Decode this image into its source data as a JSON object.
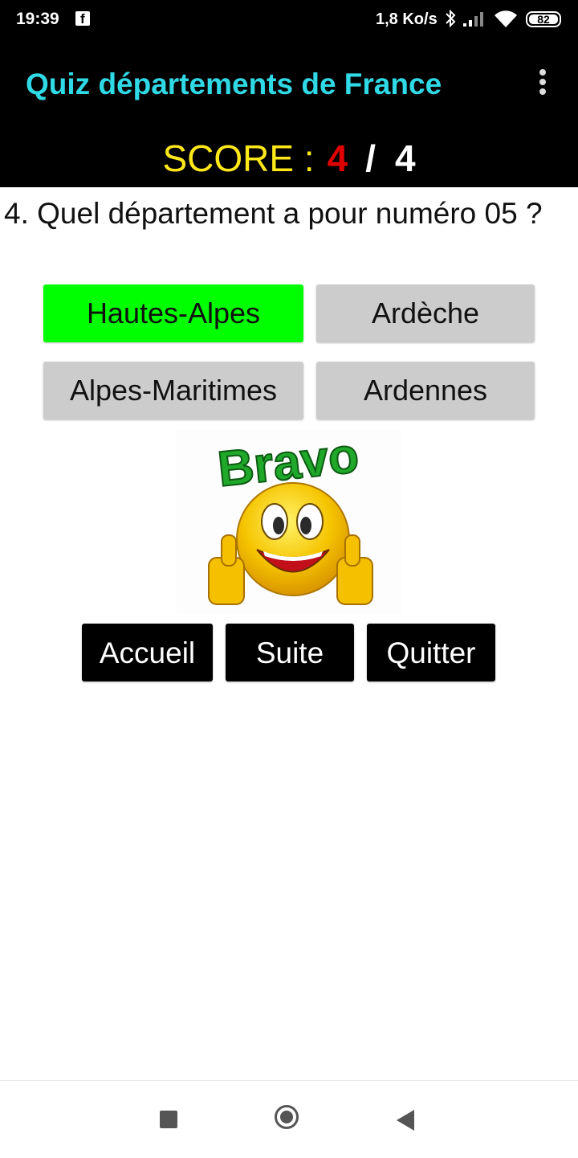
{
  "status_bar": {
    "time": "19:39",
    "network_speed": "1,8 Ko/s",
    "battery": "82",
    "icons": [
      "facebook-icon",
      "bluetooth-icon",
      "signal-icon",
      "wifi-icon",
      "battery-icon"
    ]
  },
  "app_bar": {
    "title": "Quiz départements de France",
    "menu_icon": "more-vert-icon",
    "title_color": "#2fd9e6"
  },
  "score": {
    "label": "SCORE :",
    "value": "4",
    "separator": "/",
    "total": "4",
    "colors": {
      "label": "#ffe81a",
      "value": "#e00000",
      "total": "#ffffff"
    }
  },
  "question": {
    "text": "4. Quel département a pour numéro 05 ?"
  },
  "answers": [
    {
      "label": "Hautes-Alpes",
      "state": "correct",
      "color": "#00ff00"
    },
    {
      "label": "Ardèche",
      "state": "neutral",
      "color": "#cccccc"
    },
    {
      "label": "Alpes-Maritimes",
      "state": "neutral",
      "color": "#cccccc"
    },
    {
      "label": "Ardennes",
      "state": "neutral",
      "color": "#cccccc"
    }
  ],
  "feedback": {
    "image_text": "Bravo",
    "image_icon": "thumbs-up-smiley-icon"
  },
  "actions": {
    "home": "Accueil",
    "next": "Suite",
    "quit": "Quitter"
  },
  "system_nav": {
    "icons": [
      "recents-square-icon",
      "home-circle-icon",
      "back-triangle-icon"
    ]
  }
}
